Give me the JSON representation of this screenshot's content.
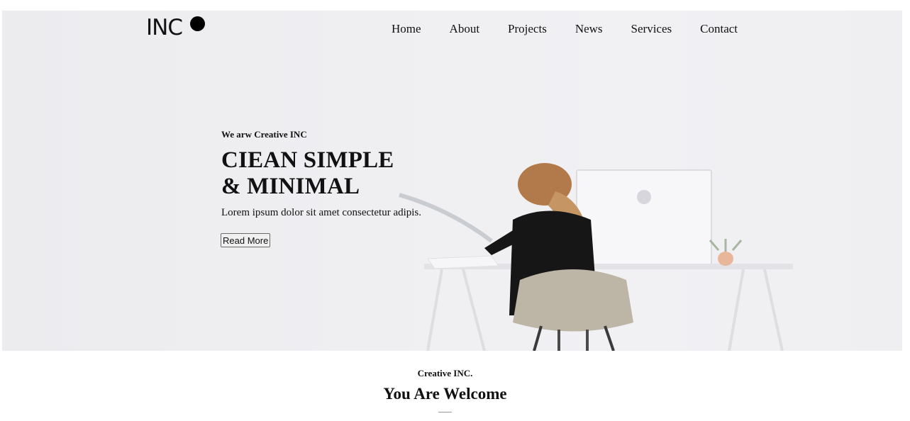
{
  "header": {
    "logo_text": "INC",
    "nav": [
      "Home",
      "About",
      "Projects",
      "News",
      "Services",
      "Contact"
    ]
  },
  "hero": {
    "eyebrow": "We arw Creative INC",
    "title_line1": "CIEAN SIMPLE",
    "title_line2": "& MINIMAL",
    "subtitle": "Lorem ipsum dolor sit amet consectetur adipis.",
    "button_label": "Read More",
    "image_subject": "woman-working-at-desk-illustration"
  },
  "welcome": {
    "eyebrow": "Creative INC.",
    "title": "You Are Welcome"
  },
  "colors": {
    "hero_background": "#efeff2",
    "text": "#111111",
    "logo_dot": "#000000"
  }
}
